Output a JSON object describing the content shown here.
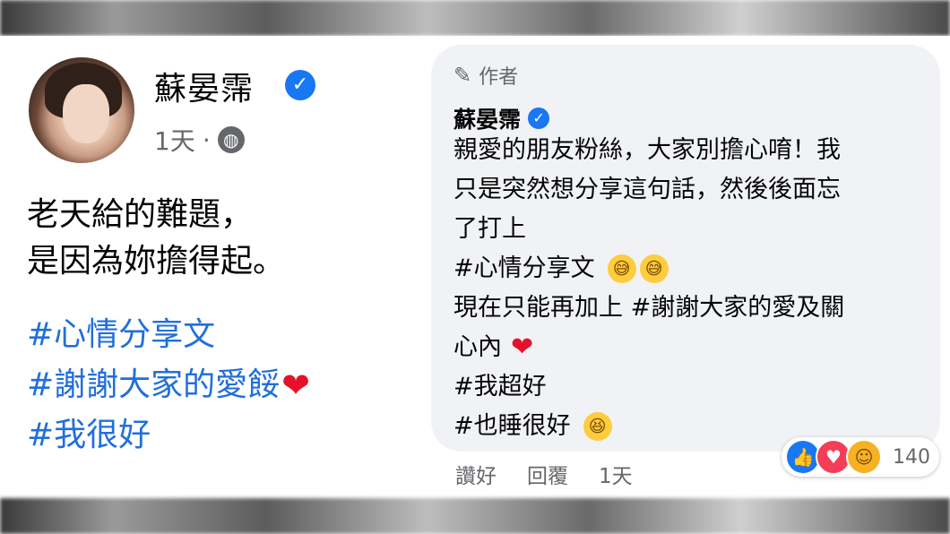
{
  "post": {
    "author_name": "蘇晏霈",
    "time": "1天",
    "separator": "·",
    "text_lines": [
      "老天給的難題，",
      "是因為妳擔得起。"
    ],
    "hashtags": [
      "#心情分享文",
      "#謝謝大家的愛餒",
      "#我很好"
    ],
    "icons": {
      "verified": "verified-badge-icon",
      "audience": "globe-icon",
      "heart": "heart-emoji"
    }
  },
  "comment": {
    "author_label": "作者",
    "author_name": "蘇晏霈",
    "lines": [
      "親愛的朋友粉絲，大家別擔心唷！我",
      "只是突然想分享這句話，然後後面忘",
      "了打上",
      "#心情分享文",
      "現在只能再加上 #謝謝大家的愛及關",
      "心內",
      "#我超好",
      "#也睡很好"
    ],
    "emoji": {
      "sweat_smile": "😅",
      "heart": "❤",
      "laughing": "😆"
    },
    "actions": {
      "like": "讚好",
      "reply": "回覆",
      "time": "1天"
    },
    "reactions": {
      "count": "140",
      "types": [
        "like",
        "love",
        "care"
      ]
    }
  },
  "colors": {
    "link": "#216fdb",
    "verified": "#1877f2",
    "bubble": "#f0f2f5",
    "meta": "#65676b"
  }
}
